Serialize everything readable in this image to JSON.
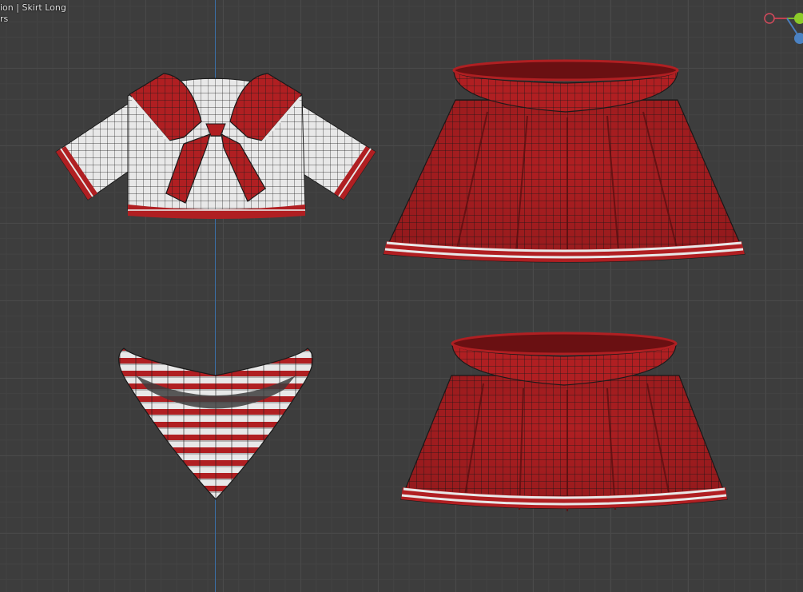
{
  "viewport": {
    "header_line1": "ion | Skirt Long",
    "header_line2": "rs"
  },
  "colors": {
    "background": "#3d3d3d",
    "grid": "#4a4a4a",
    "y_axis": "#3b6fa6",
    "garment_red": "#b01f22",
    "garment_white": "#e8e8e8",
    "wire": "#1a1a1a"
  },
  "gizmo": {
    "icons": [
      "x-axis-icon",
      "y-axis-icon",
      "z-axis-icon"
    ]
  }
}
